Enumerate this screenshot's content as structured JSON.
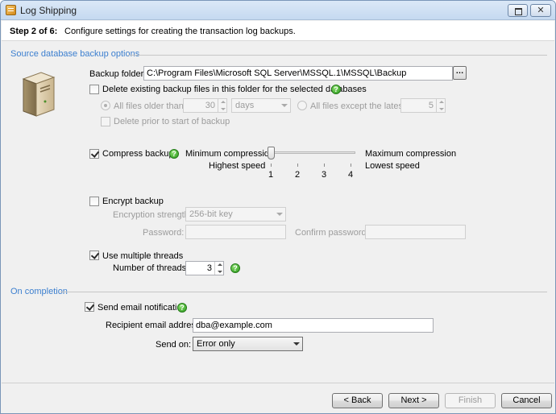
{
  "window": {
    "title": "Log Shipping"
  },
  "header": {
    "step": "Step 2 of 6:",
    "description": "Configure settings for creating the transaction log backups."
  },
  "source_section": {
    "title": "Source database backup options",
    "backup_folder_label": "Backup folder:",
    "backup_folder_value": "C:\\Program Files\\Microsoft SQL Server\\MSSQL.1\\MSSQL\\Backup",
    "browse_label": "…",
    "delete_existing": {
      "label": "Delete existing backup files in this folder for the selected databases",
      "checked": false
    },
    "all_files_older_than": {
      "label": "All files older than:",
      "value": "30",
      "unit": "days",
      "selected": true
    },
    "all_files_except_latest": {
      "label": "All files except the latest:",
      "value": "5",
      "selected": false
    },
    "delete_prior": {
      "label": "Delete prior to start of backup",
      "checked": false
    },
    "compress": {
      "label": "Compress backup",
      "checked": true,
      "min_label": "Minimum compression",
      "min_sub": "Highest speed",
      "max_label": "Maximum compression",
      "max_sub": "Lowest speed",
      "level": 1,
      "ticks": [
        "1",
        "2",
        "3",
        "4"
      ]
    },
    "encrypt": {
      "label": "Encrypt backup",
      "checked": false,
      "strength_label": "Encryption strength:",
      "strength_value": "256-bit key",
      "password_label": "Password:",
      "confirm_label": "Confirm password:"
    },
    "threads": {
      "label": "Use multiple threads",
      "checked": true,
      "count_label": "Number of threads:",
      "count_value": "3"
    }
  },
  "completion_section": {
    "title": "On completion",
    "send_email": {
      "label": "Send email notification",
      "checked": true
    },
    "recipient_label": "Recipient email address:",
    "recipient_value": "dba@example.com",
    "send_on_label": "Send on:",
    "send_on_value": "Error only"
  },
  "footer": {
    "back": "< Back",
    "next": "Next >",
    "finish": "Finish",
    "cancel": "Cancel"
  },
  "help_glyph": "?",
  "close_glyph": "✕",
  "colors": {
    "section_title": "#3c7fcf",
    "help_icon": "#2b9a1c",
    "window_bg": "#f0f0f0"
  }
}
